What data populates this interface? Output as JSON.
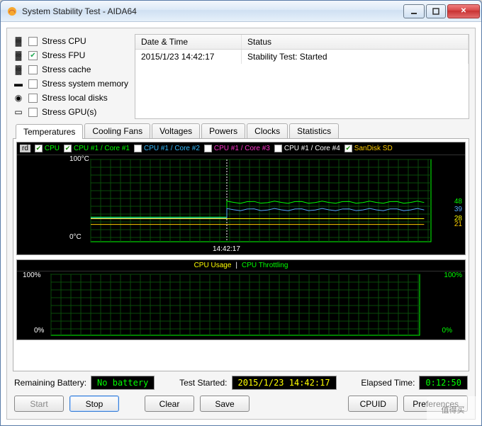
{
  "window": {
    "title": "System Stability Test - AIDA64"
  },
  "stress": {
    "items": [
      {
        "label": "Stress CPU",
        "checked": false
      },
      {
        "label": "Stress FPU",
        "checked": true
      },
      {
        "label": "Stress cache",
        "checked": false
      },
      {
        "label": "Stress system memory",
        "checked": false
      },
      {
        "label": "Stress local disks",
        "checked": false
      },
      {
        "label": "Stress GPU(s)",
        "checked": false
      }
    ]
  },
  "log": {
    "cols": {
      "datetime": "Date & Time",
      "status": "Status"
    },
    "rows": [
      {
        "datetime": "2015/1/23 14:42:17",
        "status": "Stability Test: Started"
      }
    ]
  },
  "tabs": [
    {
      "label": "Temperatures",
      "active": true
    },
    {
      "label": "Cooling Fans"
    },
    {
      "label": "Voltages"
    },
    {
      "label": "Powers"
    },
    {
      "label": "Clocks"
    },
    {
      "label": "Statistics"
    }
  ],
  "temp_legend": {
    "head": "rd",
    "items": [
      {
        "label": "CPU",
        "color": "#00ff00",
        "on": true
      },
      {
        "label": "CPU #1 / Core #1",
        "color": "#00ff00",
        "on": true
      },
      {
        "label": "CPU #1 / Core #2",
        "color": "#33bbff",
        "on": false
      },
      {
        "label": "CPU #1 / Core #3",
        "color": "#ff33cc",
        "on": false
      },
      {
        "label": "CPU #1 / Core #4",
        "color": "#ffffff",
        "on": false
      },
      {
        "label": "SanDisk SD",
        "color": "#ffcc00",
        "on": true
      }
    ]
  },
  "usage_legend": {
    "a": "CPU Usage",
    "sep": "|",
    "b": "CPU Throttling"
  },
  "chart_data": [
    {
      "type": "line",
      "title": "Temperatures",
      "ylabel": "°C",
      "ylim": [
        0,
        100
      ],
      "y_top_label": "100°C",
      "y_bot_label": "0°C",
      "event_x_label": "14:42:17",
      "event_x_frac": 0.4,
      "series": [
        {
          "name": "CPU #1 / Core #1",
          "color": "#00ff00",
          "baseline": 30,
          "active": 48,
          "end_label": "48"
        },
        {
          "name": "CPU",
          "color": "#55aaff",
          "baseline": 29,
          "active": 39,
          "end_label": "39"
        },
        {
          "name": "SanDisk SD line1",
          "color": "#ffff00",
          "baseline": 28,
          "active": 28,
          "end_label": "28"
        },
        {
          "name": "SanDisk SD line2",
          "color": "#ffcc00",
          "baseline": 21,
          "active": 21,
          "end_label": "21"
        }
      ]
    },
    {
      "type": "line",
      "title": "CPU Usage / Throttling",
      "ylabel": "%",
      "ylim": [
        0,
        100
      ],
      "left_top": "100%",
      "left_bot": "0%",
      "right_top": "100%",
      "right_bot": "0%",
      "series": [
        {
          "name": "CPU Usage",
          "color": "#ffff00",
          "value": 0
        },
        {
          "name": "CPU Throttling",
          "color": "#00ff00",
          "value": 0
        }
      ]
    }
  ],
  "status": {
    "battery_label": "Remaining Battery:",
    "battery_value": "No battery",
    "started_label": "Test Started:",
    "started_value": "2015/1/23 14:42:17",
    "elapsed_label": "Elapsed Time:",
    "elapsed_value": "0:12:50"
  },
  "buttons": {
    "start": "Start",
    "stop": "Stop",
    "clear": "Clear",
    "save": "Save",
    "cpuid": "CPUID",
    "prefs": "Preferences"
  },
  "watermark": "值得买"
}
